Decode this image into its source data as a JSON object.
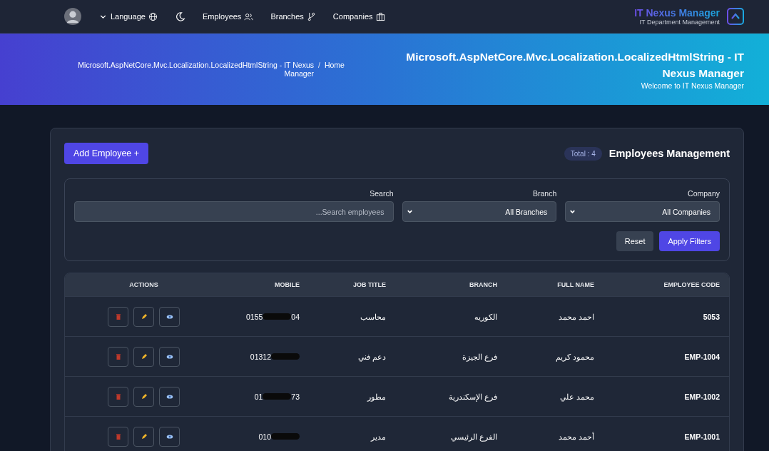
{
  "nav": {
    "language": "Language",
    "links": [
      {
        "label": "Employees"
      },
      {
        "label": "Branches"
      },
      {
        "label": "Companies"
      }
    ],
    "brand": "IT Nexus Manager",
    "tagline": "IT Department Management"
  },
  "hero": {
    "breadcrumb": [
      "Microsoft.AspNetCore.Mvc.Localization.LocalizedHtmlString - IT Nexus Manager",
      "/",
      "Home"
    ],
    "title": "Microsoft.AspNetCore.Mvc.Localization.LocalizedHtmlString - IT Nexus Manager",
    "subtitle": "Welcome to IT Nexus Manager"
  },
  "header": {
    "title": "Employees Management",
    "total": "Total : 4",
    "add_button": "Add Employee +"
  },
  "filters": {
    "company_label": "Company",
    "company_value": "All Companies",
    "branch_label": "Branch",
    "branch_value": "All Branches",
    "search_label": "Search",
    "search_placeholder": "...Search employees",
    "reset": "Reset",
    "apply": "Apply Filters"
  },
  "table": {
    "columns": [
      "ACTIONS",
      "MOBILE",
      "JOB TITLE",
      "BRANCH",
      "FULL NAME",
      "EMPLOYEE CODE"
    ],
    "rows": [
      {
        "code": "5053",
        "name": "احمد محمد",
        "branch": "الكوريه",
        "job": "محاسب",
        "mobile_start": "0155",
        "mobile_end": "04"
      },
      {
        "code": "EMP-1004",
        "name": "محمود كريم",
        "branch": "فرع الجيزة",
        "job": "دعم فني",
        "mobile_start": "01312"
      },
      {
        "code": "EMP-1002",
        "name": "محمد علي",
        "branch": "فرع الإسكندرية",
        "job": "مطور",
        "mobile_start": "01",
        "mobile_end": "73"
      },
      {
        "code": "EMP-1001",
        "name": "أحمد محمد",
        "branch": "الفرع الرئيسي",
        "job": "مدير",
        "mobile_start": "010"
      }
    ]
  }
}
